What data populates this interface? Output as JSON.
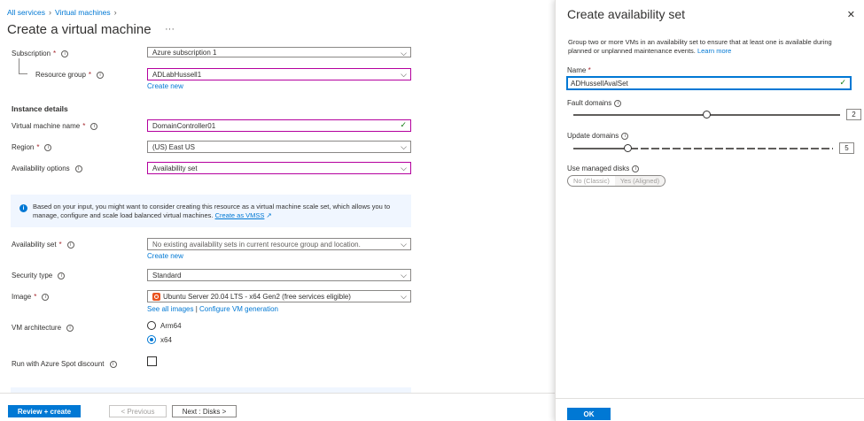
{
  "breadcrumb": [
    "All services",
    "Virtual machines"
  ],
  "page_title": "Create a virtual machine",
  "more": "···",
  "form": {
    "subscription_label": "Subscription",
    "subscription_value": "Azure subscription 1",
    "resource_group_label": "Resource group",
    "resource_group_value": "ADLabHussell1",
    "create_new": "Create new",
    "instance_details": "Instance details",
    "vm_name_label": "Virtual machine name",
    "vm_name_value": "DomainController01",
    "region_label": "Region",
    "region_value": "(US) East US",
    "availability_options_label": "Availability options",
    "availability_options_value": "Availability set",
    "info_text": "Based on your input, you might want to consider creating this resource as a virtual machine scale set, which allows you to manage, configure and scale load balanced virtual machines.",
    "info_link": "Create as VMSS",
    "availability_set_label": "Availability set",
    "availability_set_placeholder": "No existing availability sets in current resource group and location.",
    "security_type_label": "Security type",
    "security_type_value": "Standard",
    "image_label": "Image",
    "image_value": "Ubuntu Server 20.04 LTS - x64 Gen2 (free services eligible)",
    "see_all_images": "See all images",
    "link_sep": "|",
    "configure_vm_generation": "Configure VM generation",
    "vm_architecture_label": "VM architecture",
    "arch_options": [
      "Arm64",
      "x64"
    ],
    "arch_selected": "x64",
    "spot_label": "Run with Azure Spot discount"
  },
  "footer": {
    "review_create": "Review + create",
    "previous": "< Previous",
    "next": "Next : Disks >"
  },
  "panel": {
    "title": "Create availability set",
    "description": "Group two or more VMs in an availability set to ensure that at least one is available during planned or unplanned maintenance events.",
    "learn_more": "Learn more",
    "name_label": "Name",
    "name_value": "ADHussellAvalSet",
    "fault_domains_label": "Fault domains",
    "fault_domains_value": "2",
    "update_domains_label": "Update domains",
    "update_domains_value": "5",
    "managed_disks_label": "Use managed disks",
    "managed_disks_options": [
      "No (Classic)",
      "Yes (Aligned)"
    ],
    "ok": "OK"
  },
  "colors": {
    "accent": "#0078d4",
    "required": "#a4262c",
    "valid": "#107c10"
  }
}
